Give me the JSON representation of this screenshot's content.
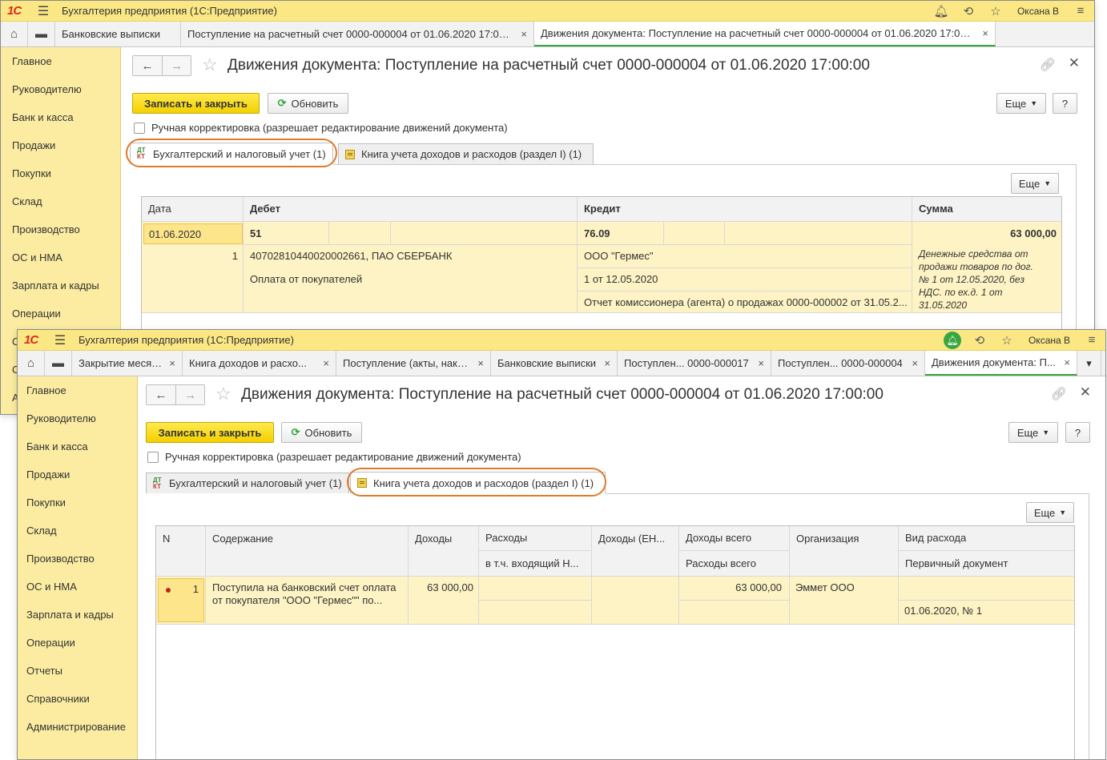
{
  "back": {
    "app_title": "Бухгалтерия предприятия  (1С:Предприятие)",
    "user": "Оксана В",
    "tabs": [
      {
        "label": "Банковские выписки",
        "close": "×"
      },
      {
        "label": "Поступление на расчетный счет 0000-000004 от 01.06.2020 17:00:00",
        "close": "×"
      },
      {
        "label": "Движения документа: Поступление на расчетный счет 0000-000004 от 01.06.2020 17:00:00",
        "close": "×"
      }
    ],
    "sidebar": [
      "Главное",
      "Руководителю",
      "Банк и касса",
      "Продажи",
      "Покупки",
      "Склад",
      "Производство",
      "ОС и НМА",
      "Зарплата и кадры",
      "Операции",
      "О",
      "О",
      "А"
    ],
    "doc_title": "Движения документа: Поступление на расчетный счет 0000-000004 от 01.06.2020 17:00:00",
    "save_close": "Записать и закрыть",
    "refresh": "Обновить",
    "more": "Еще",
    "help": "?",
    "manual": "Ручная корректировка (разрешает редактирование движений документа)",
    "form_tabs": [
      "Бухгалтерский и налоговый учет (1)",
      "Книга учета доходов и расходов (раздел I) (1)"
    ],
    "grid_more": "Еще",
    "columns": [
      "Дата",
      "Дебет",
      "Кредит",
      "Сумма"
    ],
    "row": {
      "date": "01.06.2020",
      "debit_account": "51",
      "credit_account": "76.09",
      "sum": "63 000,00",
      "line_no": "1",
      "debit_sub1": "40702810440020002661, ПАО СБЕРБАНК",
      "debit_sub2": "Оплата от покупателей",
      "credit_sub1": "ООО \"Гермес\"",
      "credit_sub2": "1 от 12.05.2020",
      "credit_sub3": "Отчет комиссионера (агента) о продажах 0000-000002 от 31.05.2...",
      "content_lines": [
        "Денежные средства от",
        "продажи товаров по дог.",
        "№ 1 от 12.05.2020, без",
        "НДС. по ех.д. 1 от",
        "31.05.2020"
      ]
    }
  },
  "front": {
    "app_title": "Бухгалтерия предприятия  (1С:Предприятие)",
    "user": "Оксана В",
    "tabs": [
      {
        "label": "Закрытие месяца",
        "close": "×"
      },
      {
        "label": "Книга доходов и расхо...",
        "close": "×"
      },
      {
        "label": "Поступление (акты, накл...",
        "close": "×"
      },
      {
        "label": "Банковские выписки",
        "close": "×"
      },
      {
        "label": "Поступлен...    0000-000017",
        "close": "×"
      },
      {
        "label": "Поступлен...    0000-000004",
        "close": "×"
      },
      {
        "label": "Движения документа: П...",
        "close": "×"
      }
    ],
    "tabs_menu": "▾",
    "sidebar": [
      "Главное",
      "Руководителю",
      "Банк и касса",
      "Продажи",
      "Покупки",
      "Склад",
      "Производство",
      "ОС и НМА",
      "Зарплата и кадры",
      "Операции",
      "Отчеты",
      "Справочники",
      "Администрирование"
    ],
    "doc_title": "Движения документа: Поступление на расчетный счет 0000-000004 от 01.06.2020 17:00:00",
    "save_close": "Записать и закрыть",
    "refresh": "Обновить",
    "more": "Еще",
    "help": "?",
    "manual": "Ручная корректировка (разрешает редактирование движений документа)",
    "form_tabs": [
      "Бухгалтерский и налоговый учет (1)",
      "Книга учета доходов и расходов (раздел I) (1)"
    ],
    "grid_more": "Еще",
    "columns": {
      "n": "N",
      "content": "Содержание",
      "income": "Доходы",
      "expense": "Расходы",
      "expense_incl": "в т.ч. входящий Н...",
      "income_en": "Доходы (ЕН...",
      "income_total": "Доходы всего",
      "expense_total": "Расходы всего",
      "org": "Организация",
      "expense_type": "Вид расхода",
      "primary_doc": "Первичный документ"
    },
    "row": {
      "n": "1",
      "content_line1": "Поступила на банковский счет оплата",
      "content_line2": "от покупателя \"ООО \"Гермес\"\" по...",
      "income": "63 000,00",
      "income_total": "63 000,00",
      "org": "Эммет ООО",
      "primary_doc": "01.06.2020, № 1"
    }
  }
}
